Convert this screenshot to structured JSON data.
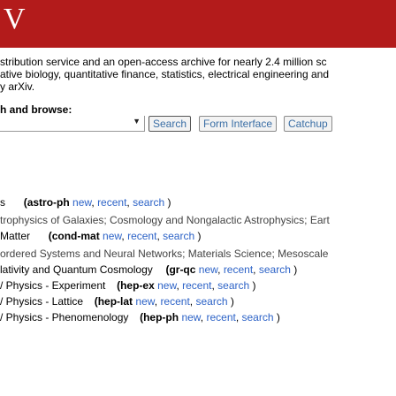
{
  "header": {
    "logo": "V",
    "bg": "#b31b1b"
  },
  "intro": {
    "line1": "stribution service and an open-access archive for nearly 2.4 million sc",
    "line2": "ative biology, quantitative finance, statistics, electrical engineering and",
    "line3": "y arXiv."
  },
  "browse": {
    "title": "h and browse:"
  },
  "search": {
    "select_arrow": "▼",
    "search_label": "Search",
    "form_label": "Form Interface",
    "catchup_label": "Catchup"
  },
  "archives": {
    "astro": {
      "prefix": "s",
      "open": "(",
      "code": "astro-ph",
      "new": "new",
      "recent": "recent",
      "search": "search",
      "close": ")",
      "sub": "trophysics of Galaxies; Cosmology and Nongalactic Astrophysics; Eart"
    },
    "condmat": {
      "prefix": "Matter",
      "open": "(",
      "code": "cond-mat",
      "new": "new",
      "recent": "recent",
      "search": "search",
      "close": ")",
      "sub": "ordered Systems and Neural Networks; Materials Science; Mesoscale"
    },
    "grqc": {
      "prefix": "lativity and Quantum Cosmology",
      "open": "(",
      "code": "gr-qc",
      "new": "new",
      "recent": "recent",
      "search": "search",
      "close": ")"
    },
    "hepex": {
      "prefix": "/ Physics - Experiment",
      "open": "(",
      "code": "hep-ex",
      "new": "new",
      "recent": "recent",
      "search": "search",
      "close": ")"
    },
    "heplat": {
      "prefix": "/ Physics - Lattice",
      "open": "(",
      "code": "hep-lat",
      "new": "new",
      "recent": "recent",
      "search": "search",
      "close": ")"
    },
    "hepph": {
      "prefix": "/ Physics - Phenomenology",
      "open": "(",
      "code": "hep-ph",
      "new": "new",
      "recent": "recent",
      "search": "search",
      "close": ")"
    }
  }
}
